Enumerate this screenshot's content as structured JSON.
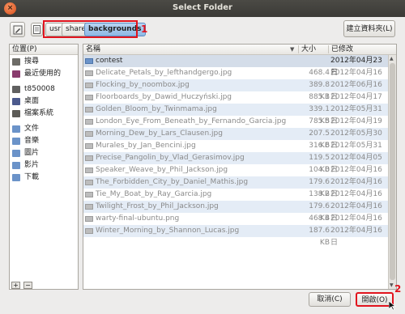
{
  "window": {
    "title": "Select Folder",
    "close_glyph": "×"
  },
  "toolbar": {
    "location_toggle_icon": "pencil-icon",
    "breadcrumb_back_icon": "page-icon",
    "breadcrumbs": [
      "usr",
      "share",
      "backgrounds"
    ],
    "create_folder_label": "建立資料夾(L)"
  },
  "annotations": {
    "first": "1",
    "second": "2"
  },
  "places": {
    "header": "位置(P)",
    "items": [
      {
        "label": "搜尋",
        "icon": "search-icon"
      },
      {
        "label": "最近使用的",
        "icon": "recent-icon"
      },
      {
        "label": "t850008",
        "icon": "home-icon"
      },
      {
        "label": "桌面",
        "icon": "desktop-icon"
      },
      {
        "label": "檔案系統",
        "icon": "filesystem-icon"
      },
      {
        "label": "文件",
        "icon": "folder-icon"
      },
      {
        "label": "音樂",
        "icon": "folder-icon"
      },
      {
        "label": "圖片",
        "icon": "folder-icon"
      },
      {
        "label": "影片",
        "icon": "folder-icon"
      },
      {
        "label": "下載",
        "icon": "folder-icon"
      }
    ],
    "add_label": "+",
    "remove_label": "−"
  },
  "files": {
    "columns": {
      "name": "名稱",
      "size": "大小",
      "modified": "已修改"
    },
    "sort_indicator": "▼",
    "rows": [
      {
        "name": "contest",
        "size": "",
        "modified": "2012年04月23日",
        "type": "folder"
      },
      {
        "name": "Delicate_Petals_by_lefthandgergo.jpg",
        "size": "468.4 KB",
        "modified": "2012年04月16日",
        "type": "file"
      },
      {
        "name": "Flocking_by_noombox.jpg",
        "size": "389.8 KB",
        "modified": "2012年06月16日",
        "type": "file"
      },
      {
        "name": "Floorboards_by_Dawid_Huczyński.jpg",
        "size": "885.1 KB",
        "modified": "2012年04月17日",
        "type": "file"
      },
      {
        "name": "Golden_Bloom_by_Twinmama.jpg",
        "size": "339.1 KB",
        "modified": "2012年05月31日",
        "type": "file"
      },
      {
        "name": "London_Eye_From_Beneath_by_Fernando_Garcia.jpg",
        "size": "785.5 KB",
        "modified": "2012年04月19日",
        "type": "file"
      },
      {
        "name": "Morning_Dew_by_Lars_Clausen.jpg",
        "size": "207.5 KB",
        "modified": "2012年05月30日",
        "type": "file"
      },
      {
        "name": "Murales_by_Jan_Bencini.jpg",
        "size": "316.6 KB",
        "modified": "2012年05月31日",
        "type": "file"
      },
      {
        "name": "Precise_Pangolin_by_Vlad_Gerasimov.jpg",
        "size": "119.5 KB",
        "modified": "2012年04月05日",
        "type": "file"
      },
      {
        "name": "Speaker_Weave_by_Phil_Jackson.jpg",
        "size": "104.0 KB",
        "modified": "2012年04月16日",
        "type": "file"
      },
      {
        "name": "The_Forbidden_City_by_Daniel_Mathis.jpg",
        "size": "179.6 KB",
        "modified": "2012年04月16日",
        "type": "file"
      },
      {
        "name": "Tie_My_Boat_by_Ray_Garcia.jpg",
        "size": "138.2 KB",
        "modified": "2012年04月16日",
        "type": "file"
      },
      {
        "name": "Twilight_Frost_by_Phil_Jackson.jpg",
        "size": "179.6 KB",
        "modified": "2012年04月16日",
        "type": "file"
      },
      {
        "name": "warty-final-ubuntu.png",
        "size": "468.4 KB",
        "modified": "2012年04月16日",
        "type": "file"
      },
      {
        "name": "Winter_Morning_by_Shannon_Lucas.jpg",
        "size": "187.6 KB",
        "modified": "2012年04月16日",
        "type": "file"
      }
    ]
  },
  "actions": {
    "cancel_label": "取消(C)",
    "open_label": "開啟(O)"
  },
  "colors": {
    "annotation_red": "#e1141e",
    "selection_blue": "#8fb8e5"
  }
}
